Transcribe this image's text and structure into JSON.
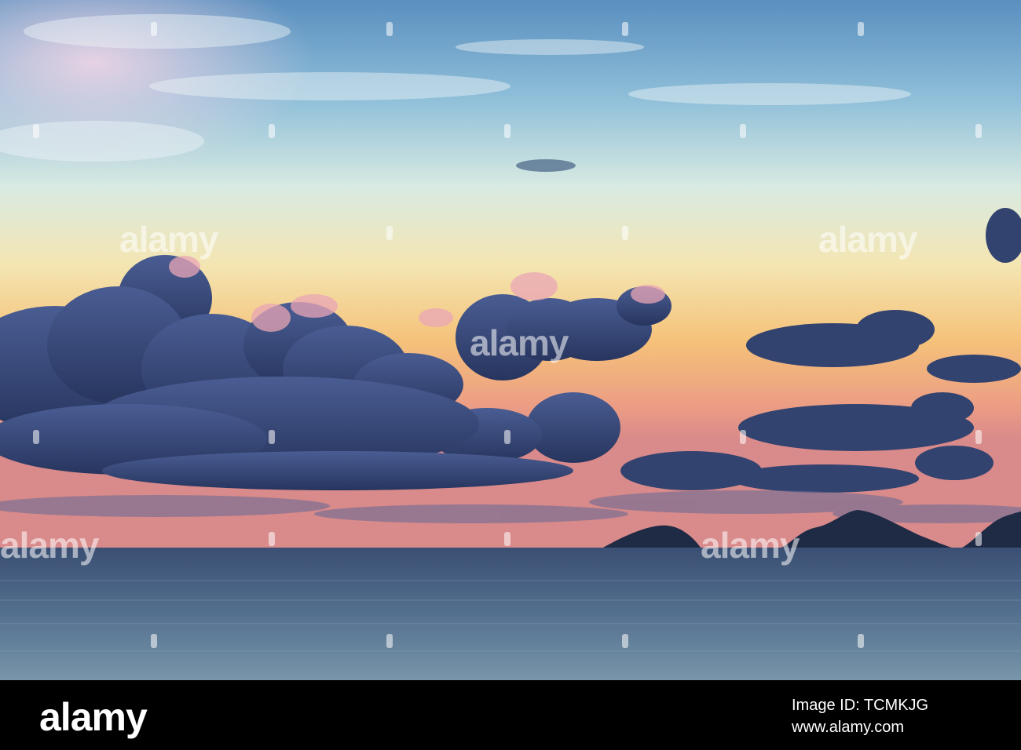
{
  "photo": {
    "subject": "",
    "watermark_text": "alamy"
  },
  "footer": {
    "brand": "alamy",
    "image_id_label": "Image ID: TCMKJG",
    "site": "www.alamy.com"
  },
  "colors": {
    "sky_top": "#5f95c2",
    "sky_mid": "#cfe3e8",
    "sky_glow": "#f6c77f",
    "horizon_pink": "#e88f86",
    "cloud": "#2e3f6e",
    "sea": "#4c6b8a",
    "footer": "#000000"
  }
}
